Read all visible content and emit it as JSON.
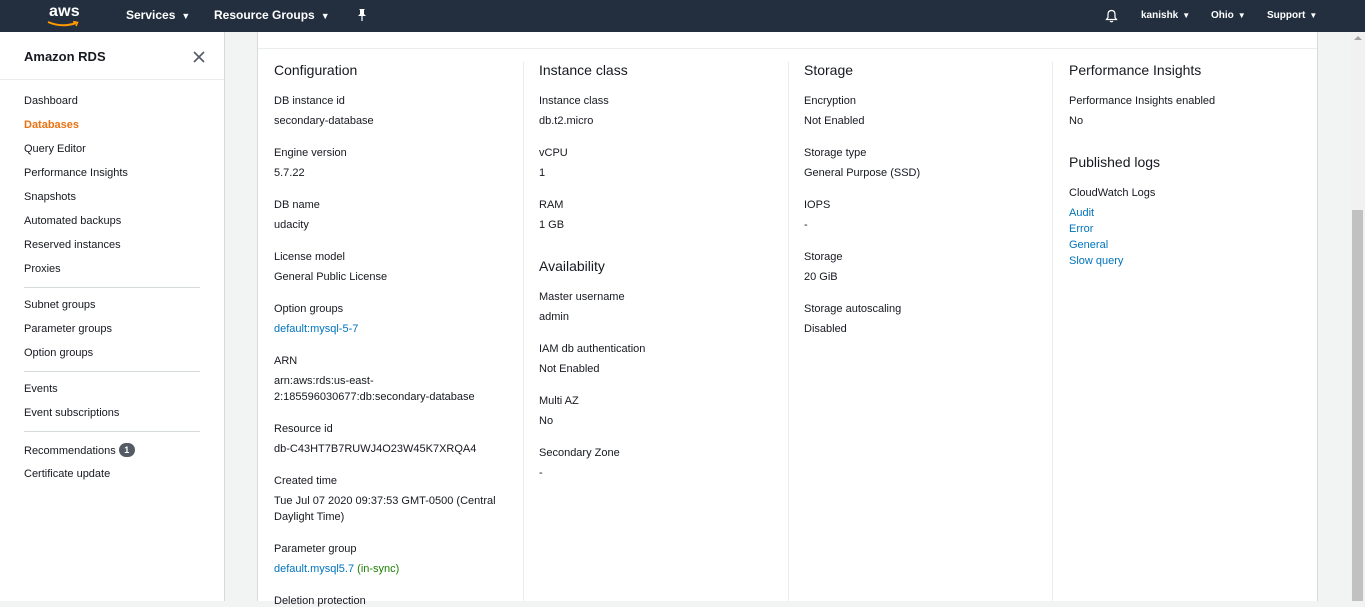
{
  "topnav": {
    "logo": "aws",
    "services": "Services",
    "resource_groups": "Resource Groups",
    "user": "kanishk",
    "region": "Ohio",
    "support": "Support"
  },
  "sidebar": {
    "title": "Amazon RDS",
    "items": [
      {
        "label": "Dashboard"
      },
      {
        "label": "Databases"
      },
      {
        "label": "Query Editor"
      },
      {
        "label": "Performance Insights"
      },
      {
        "label": "Snapshots"
      },
      {
        "label": "Automated backups"
      },
      {
        "label": "Reserved instances"
      },
      {
        "label": "Proxies"
      },
      {
        "label": "Subnet groups"
      },
      {
        "label": "Parameter groups"
      },
      {
        "label": "Option groups"
      },
      {
        "label": "Events"
      },
      {
        "label": "Event subscriptions"
      },
      {
        "label": "Recommendations",
        "badge": "1"
      },
      {
        "label": "Certificate update"
      }
    ]
  },
  "configuration": {
    "title": "Configuration",
    "db_instance_id_label": "DB instance id",
    "db_instance_id": "secondary-database",
    "engine_version_label": "Engine version",
    "engine_version": "5.7.22",
    "db_name_label": "DB name",
    "db_name": "udacity",
    "license_model_label": "License model",
    "license_model": "General Public License",
    "option_groups_label": "Option groups",
    "option_groups": "default:mysql-5-7",
    "arn_label": "ARN",
    "arn_line1": "arn:aws:rds:us-east-",
    "arn_line2": "2:185596030677:db:secondary-database",
    "resource_id_label": "Resource id",
    "resource_id": "db-C43HT7B7RUWJ4O23W45K7XRQA4",
    "created_time_label": "Created time",
    "created_time_line1": "Tue Jul 07 2020 09:37:53 GMT-0500 (Central",
    "created_time_line2": "Daylight Time)",
    "parameter_group_label": "Parameter group",
    "parameter_group": "default.mysql5.7",
    "parameter_group_status": "(in-sync)",
    "deletion_protection_label": "Deletion protection"
  },
  "instance_class": {
    "title": "Instance class",
    "instance_class_label": "Instance class",
    "instance_class": "db.t2.micro",
    "vcpu_label": "vCPU",
    "vcpu": "1",
    "ram_label": "RAM",
    "ram": "1 GB"
  },
  "availability": {
    "title": "Availability",
    "master_username_label": "Master username",
    "master_username": "admin",
    "iam_label": "IAM db authentication",
    "iam": "Not Enabled",
    "multi_az_label": "Multi AZ",
    "multi_az": "No",
    "secondary_zone_label": "Secondary Zone",
    "secondary_zone": "-"
  },
  "storage": {
    "title": "Storage",
    "encryption_label": "Encryption",
    "encryption": "Not Enabled",
    "storage_type_label": "Storage type",
    "storage_type": "General Purpose (SSD)",
    "iops_label": "IOPS",
    "iops": "-",
    "storage_label": "Storage",
    "storage": "20 GiB",
    "autoscaling_label": "Storage autoscaling",
    "autoscaling": "Disabled"
  },
  "performance_insights": {
    "title": "Performance Insights",
    "enabled_label": "Performance Insights enabled",
    "enabled": "No"
  },
  "published_logs": {
    "title": "Published logs",
    "cloudwatch_label": "CloudWatch Logs",
    "logs": [
      "Audit",
      "Error",
      "General",
      "Slow query"
    ]
  },
  "colors": {
    "nav_bg": "#232f3e",
    "accent": "#ec7211",
    "link": "#0073bb",
    "success": "#1d8102"
  }
}
